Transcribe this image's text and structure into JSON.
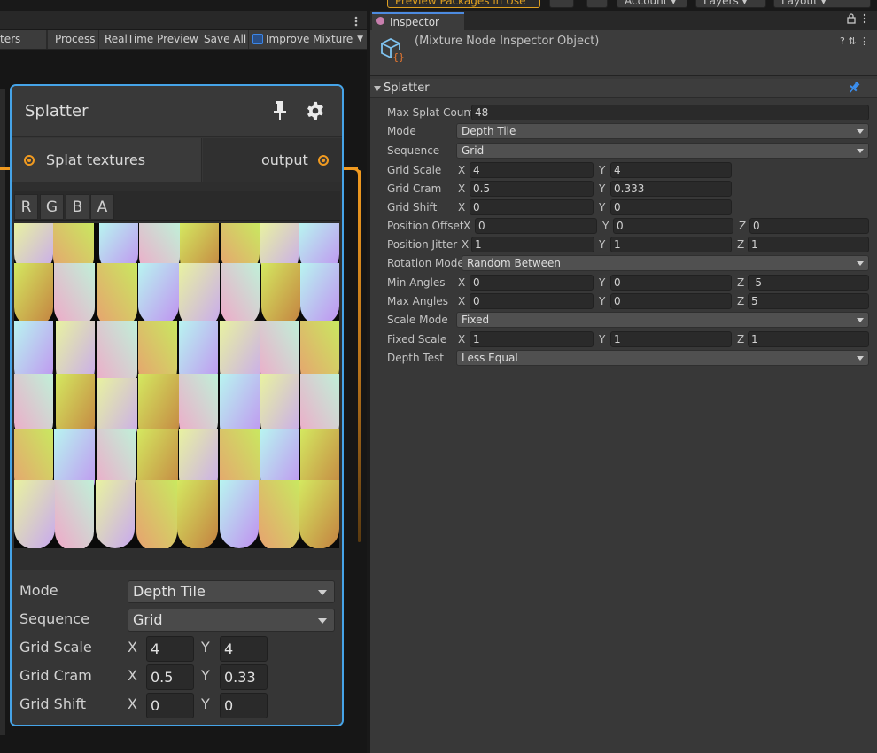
{
  "topbar": {
    "preview_packages": "Preview Packages in Use",
    "account": "Account",
    "layers": "Layers",
    "layout": "Layout"
  },
  "graph": {
    "toolbar": {
      "partial_left": "ters",
      "process": "Process",
      "realtime_preview": "RealTime Preview",
      "save_all": "Save All",
      "improve_mixture": "Improve Mixture"
    },
    "node": {
      "title": "Splatter",
      "input_port": "Splat textures",
      "output_port": "output",
      "channels": [
        "R",
        "G",
        "B",
        "A"
      ],
      "fields": {
        "mode_label": "Mode",
        "mode_value": "Depth Tile",
        "sequence_label": "Sequence",
        "sequence_value": "Grid",
        "grid_scale_label": "Grid Scale",
        "grid_scale_x": "4",
        "grid_scale_y": "4",
        "grid_cram_label": "Grid Cram",
        "grid_cram_x": "0.5",
        "grid_cram_y": "0.33",
        "grid_shift_label": "Grid Shift",
        "grid_shift_x": "0",
        "grid_shift_y": "0",
        "x_axis": "X",
        "y_axis": "Y"
      }
    }
  },
  "inspector": {
    "tab_label": "Inspector",
    "object_title": "(Mixture Node Inspector Object)",
    "header_icons": "? ⇅ ⋮",
    "section_title": "Splatter",
    "axis": {
      "x": "X",
      "y": "Y",
      "z": "Z"
    },
    "rows": {
      "max_splat_count": {
        "label": "Max Splat Count",
        "value": "48"
      },
      "mode": {
        "label": "Mode",
        "value": "Depth Tile"
      },
      "sequence": {
        "label": "Sequence",
        "value": "Grid"
      },
      "grid_scale": {
        "label": "Grid Scale",
        "x": "4",
        "y": "4"
      },
      "grid_cram": {
        "label": "Grid Cram",
        "x": "0.5",
        "y": "0.333"
      },
      "grid_shift": {
        "label": "Grid Shift",
        "x": "0",
        "y": "0"
      },
      "position_offset": {
        "label": "Position Offset",
        "x": "0",
        "y": "0",
        "z": "0"
      },
      "position_jitter": {
        "label": "Position Jitter",
        "x": "1",
        "y": "1",
        "z": "1"
      },
      "rotation_mode": {
        "label": "Rotation Mode",
        "value": "Random Between"
      },
      "min_angles": {
        "label": "Min Angles",
        "x": "0",
        "y": "0",
        "z": "-5"
      },
      "max_angles": {
        "label": "Max Angles",
        "x": "0",
        "y": "0",
        "z": "5"
      },
      "scale_mode": {
        "label": "Scale Mode",
        "value": "Fixed"
      },
      "fixed_scale": {
        "label": "Fixed Scale",
        "x": "1",
        "y": "1",
        "z": "1"
      },
      "depth_test": {
        "label": "Depth Test",
        "value": "Less Equal"
      }
    }
  },
  "colors": {
    "accent_blue": "#46a4e8",
    "wire_orange": "#f09a20",
    "warning_yellow": "#e0a020",
    "pin_blue": "#3b8ff0"
  }
}
